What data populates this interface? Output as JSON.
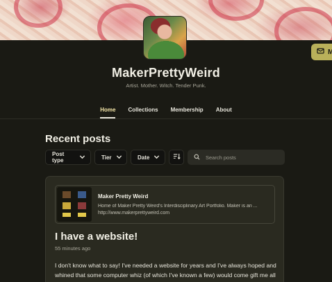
{
  "creator": {
    "name": "MakerPrettyWeird",
    "tagline": "Artist. Mother. Witch. Tender Punk."
  },
  "membership_pill": {
    "label": "M",
    "icon": "mail-icon"
  },
  "nav": {
    "tabs": [
      {
        "label": "Home",
        "active": true
      },
      {
        "label": "Collections",
        "active": false
      },
      {
        "label": "Membership",
        "active": false
      },
      {
        "label": "About",
        "active": false
      }
    ]
  },
  "recent": {
    "title": "Recent posts",
    "filters": [
      {
        "label": "Post type"
      },
      {
        "label": "Tier"
      },
      {
        "label": "Date"
      }
    ],
    "sort_icon": "sort-icon",
    "search_placeholder": "Search posts"
  },
  "post": {
    "link": {
      "title": "Maker Pretty Weird",
      "description": "Home of Maker Pretty Weird's Interdisciplinary Art Portfolio. Maker is an ...",
      "url": "http://www.makerprettyweird.com"
    },
    "title": "I have a website!",
    "time": "55 minutes ago",
    "body": "I don't know what to say! I've needed a website for years and I've always hoped and whined that some computer whiz (of which I've known a few) would come gift me all"
  },
  "colors": {
    "background": "#1a1a14",
    "accent": "#b9b05a",
    "active_tab": "#f4e6a8",
    "card": "#2a2a20"
  }
}
